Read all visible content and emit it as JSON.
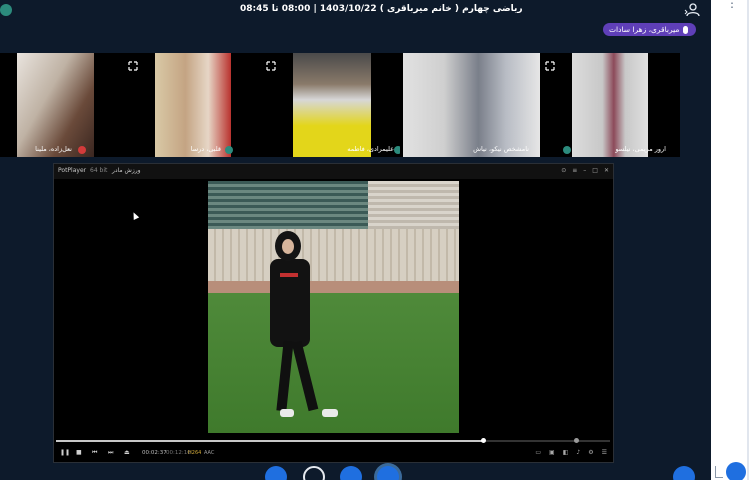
{
  "header": {
    "session_title": "ریاضی چهارم ( خانم میرباقری ) 1403/10/22 | 08:00 تا 08:45",
    "speaker_chip": "میرباقری، زهرا سادات"
  },
  "participants": [
    {
      "name": "ارور مریمی، نیلسو",
      "badge_color": "#2c8b7d"
    },
    {
      "name": "نامشخص نیکو، نیاش",
      "badge_color": "#2c8b7d"
    },
    {
      "name": "علیمرادی، فاطمه",
      "badge_color": "#2c8b7d"
    },
    {
      "name": "قلبی، درسا",
      "badge_color": "#2c8b7d"
    },
    {
      "name": "نعل‌زاده، ملینا",
      "badge_color": "#d33b3b"
    }
  ],
  "player": {
    "app_name": "PotPlayer",
    "version": "64 bit",
    "file_name": "ورزش مادر",
    "current_time": "00:02:37",
    "total_time": "00:12:16",
    "codec_tags": [
      "H264",
      "AAC"
    ],
    "progress": 0.77
  },
  "colors": {
    "background": "#0d1a2b",
    "accent": "#1f6fe0",
    "chip": "#5f3fb8"
  }
}
